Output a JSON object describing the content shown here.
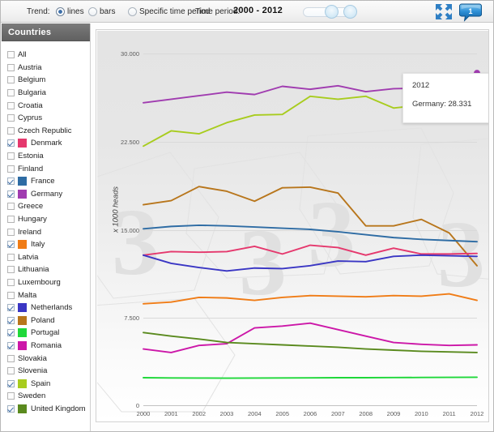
{
  "toolbar": {
    "trend_label": "Trend:",
    "radio_lines": "lines",
    "radio_bars": "bars",
    "radio_specific": "Specific time period",
    "time_period_label": "Time period:",
    "time_period_value": "2000 - 2012",
    "selected_trend": "lines",
    "expand_icon": "expand-arrows-icon",
    "chat_icon": "speech-bubble-icon",
    "chat_count": "1"
  },
  "sidebar": {
    "title": "Countries",
    "items": [
      {
        "label": "All",
        "checked": false,
        "color": null
      },
      {
        "label": "Austria",
        "checked": false,
        "color": null
      },
      {
        "label": "Belgium",
        "checked": false,
        "color": null
      },
      {
        "label": "Bulgaria",
        "checked": false,
        "color": null
      },
      {
        "label": "Croatia",
        "checked": false,
        "color": null
      },
      {
        "label": "Cyprus",
        "checked": false,
        "color": null
      },
      {
        "label": "Czech Republic",
        "checked": false,
        "color": null
      },
      {
        "label": "Denmark",
        "checked": true,
        "color": "#e5386d"
      },
      {
        "label": "Estonia",
        "checked": false,
        "color": null
      },
      {
        "label": "Finland",
        "checked": false,
        "color": null
      },
      {
        "label": "France",
        "checked": true,
        "color": "#2e6ca4"
      },
      {
        "label": "Germany",
        "checked": true,
        "color": "#a03cb0"
      },
      {
        "label": "Greece",
        "checked": false,
        "color": null
      },
      {
        "label": "Hungary",
        "checked": false,
        "color": null
      },
      {
        "label": "Ireland",
        "checked": false,
        "color": null
      },
      {
        "label": "Italy",
        "checked": true,
        "color": "#f07c16"
      },
      {
        "label": "Latvia",
        "checked": false,
        "color": null
      },
      {
        "label": "Lithuania",
        "checked": false,
        "color": null
      },
      {
        "label": "Luxembourg",
        "checked": false,
        "color": null
      },
      {
        "label": "Malta",
        "checked": false,
        "color": null
      },
      {
        "label": "Netherlands",
        "checked": true,
        "color": "#3a36c4"
      },
      {
        "label": "Poland",
        "checked": true,
        "color": "#b8761c"
      },
      {
        "label": "Portugal",
        "checked": true,
        "color": "#1fd83a"
      },
      {
        "label": "Romania",
        "checked": true,
        "color": "#cc17a8"
      },
      {
        "label": "Slovakia",
        "checked": false,
        "color": null
      },
      {
        "label": "Slovenia",
        "checked": false,
        "color": null
      },
      {
        "label": "Spain",
        "checked": true,
        "color": "#a8cc1e"
      },
      {
        "label": "Sweden",
        "checked": false,
        "color": null
      },
      {
        "label": "United Kingdom",
        "checked": true,
        "color": "#5a8a1e"
      }
    ]
  },
  "tooltip": {
    "year": "2012",
    "series": "Germany",
    "value": "28.331",
    "text": "Germany: 28.331"
  },
  "chart_data": {
    "type": "line",
    "title": "",
    "xlabel": "",
    "ylabel": "x 1000 heads",
    "ylim": [
      0,
      30000
    ],
    "yticks": [
      0,
      7500,
      15000,
      22500,
      30000
    ],
    "ytick_labels": [
      "0",
      "7.500",
      "15.000",
      "22.500",
      "30.000"
    ],
    "grid": true,
    "legend_position": "sidebar",
    "categories": [
      "2000",
      "2001",
      "2002",
      "2003",
      "2004",
      "2005",
      "2006",
      "2007",
      "2008",
      "2009",
      "2010",
      "2011",
      "2012"
    ],
    "series": [
      {
        "name": "Germany",
        "color": "#a03cb0",
        "values": [
          25800,
          26100,
          26400,
          26700,
          26500,
          27200,
          26950,
          27250,
          26750,
          27000,
          27050,
          27400,
          28331
        ]
      },
      {
        "name": "Spain",
        "color": "#a8cc1e",
        "values": [
          22100,
          23400,
          23150,
          24100,
          24750,
          24800,
          26350,
          26100,
          26350,
          25350,
          25600,
          25700,
          25250
        ]
      },
      {
        "name": "Poland",
        "color": "#b8761c",
        "values": [
          17100,
          17450,
          18650,
          18250,
          17400,
          18550,
          18600,
          18100,
          15300,
          15300,
          15850,
          14700,
          11900
        ]
      },
      {
        "name": "France",
        "color": "#2e6ca4",
        "values": [
          15050,
          15250,
          15350,
          15300,
          15200,
          15100,
          15000,
          14800,
          14550,
          14300,
          14150,
          14050,
          13950
        ]
      },
      {
        "name": "Denmark",
        "color": "#e5386d",
        "values": [
          12800,
          13100,
          13050,
          13100,
          13550,
          12900,
          13650,
          13450,
          12800,
          13400,
          12900,
          12900,
          12950
        ]
      },
      {
        "name": "Netherlands",
        "color": "#3a36c4",
        "values": [
          12800,
          12100,
          11750,
          11450,
          11700,
          11650,
          11900,
          12300,
          12250,
          12700,
          12800,
          12750,
          12700
        ]
      },
      {
        "name": "Italy",
        "color": "#f07c16",
        "values": [
          8650,
          8800,
          9200,
          9150,
          8950,
          9200,
          9350,
          9300,
          9250,
          9350,
          9300,
          9500,
          8950
        ]
      },
      {
        "name": "Romania",
        "color": "#cc17a8",
        "values": [
          4800,
          4500,
          5100,
          5250,
          6600,
          6750,
          7000,
          6450,
          5900,
          5350,
          5200,
          5100,
          5150
        ]
      },
      {
        "name": "United Kingdom",
        "color": "#5a8a1e",
        "values": [
          6200,
          5900,
          5650,
          5350,
          5250,
          5150,
          5050,
          4950,
          4800,
          4700,
          4600,
          4550,
          4500
        ]
      },
      {
        "name": "Portugal",
        "color": "#1fd83a",
        "values": [
          2350,
          2330,
          2320,
          2310,
          2320,
          2330,
          2340,
          2350,
          2350,
          2360,
          2370,
          2380,
          2390
        ]
      }
    ]
  }
}
